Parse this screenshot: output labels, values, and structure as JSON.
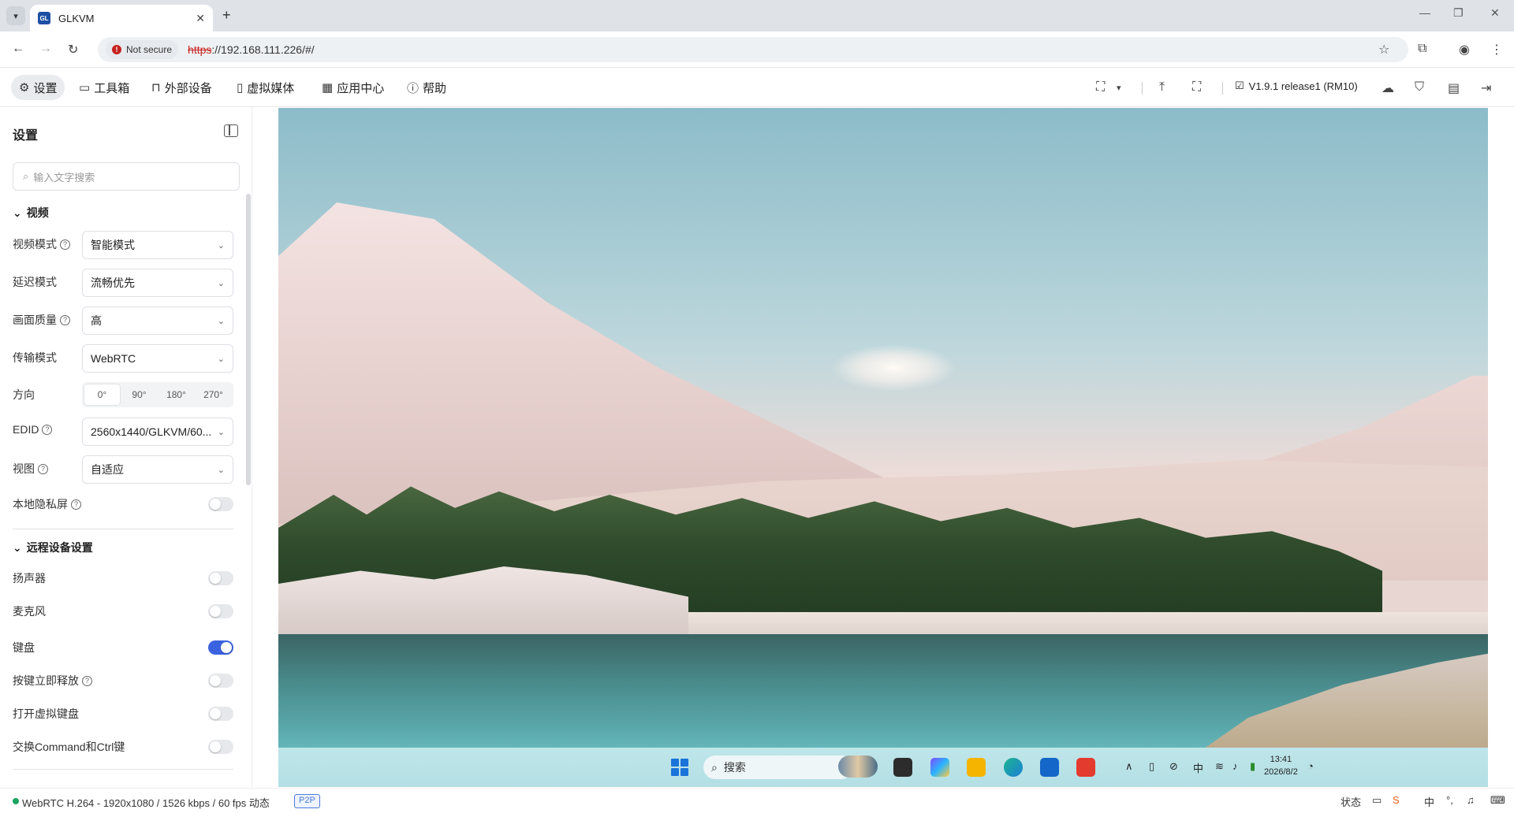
{
  "browser": {
    "tab_title": "GLKVM",
    "favicon_text": "GL",
    "security_label": "Not secure",
    "url_scheme": "https",
    "url_rest": "://192.168.111.226/#/"
  },
  "toolbar": {
    "menu": [
      {
        "label": "设置",
        "icon": "gear-icon"
      },
      {
        "label": "工具箱",
        "icon": "toolbox-icon"
      },
      {
        "label": "外部设备",
        "icon": "usb-device-icon"
      },
      {
        "label": "虚拟媒体",
        "icon": "virtual-media-icon"
      },
      {
        "label": "应用中心",
        "icon": "app-center-icon"
      },
      {
        "label": "帮助",
        "icon": "help-icon"
      }
    ],
    "version": "V1.9.1 release1 (RM10)"
  },
  "sidebar": {
    "title": "设置",
    "search_placeholder": "输入文字搜索",
    "video_section": "视频",
    "video_mode_label": "视频模式",
    "video_mode_value": "智能模式",
    "latency_label": "延迟模式",
    "latency_value": "流畅优先",
    "quality_label": "画面质量",
    "quality_value": "高",
    "transport_label": "传输模式",
    "transport_value": "WebRTC",
    "direction_label": "方向",
    "directions": [
      "0°",
      "90°",
      "180°",
      "270°"
    ],
    "edid_label": "EDID",
    "edid_value": "2560x1440/GLKVM/60...",
    "view_label": "视图",
    "view_value": "自适应",
    "privacy_label": "本地隐私屏",
    "remote_section": "远程设备设置",
    "speaker_label": "扬声器",
    "mic_label": "麦克风",
    "keyboard_label": "键盘",
    "key_release_label": "按键立即释放",
    "vkb_label": "打开虚拟键盘",
    "swap_label": "交换Command和Ctrl键",
    "toggles": {
      "privacy": false,
      "speaker": false,
      "mic": false,
      "keyboard": true,
      "key_release": false,
      "vkb": false,
      "swap": false
    }
  },
  "remote": {
    "taskbar_search": "搜索",
    "tray_ime": "中",
    "clock_time": "13:41",
    "clock_date": "2026/8/2"
  },
  "status": {
    "stream_info": "WebRTC H.264 - 1920x1080 / 1526 kbps / 60 fps 动态",
    "badge": "P2P",
    "state_label": "状态",
    "ime_label": "中"
  },
  "colors": {
    "accent": "#3b63e0",
    "online": "#1aa361",
    "danger": "#c5221f"
  }
}
